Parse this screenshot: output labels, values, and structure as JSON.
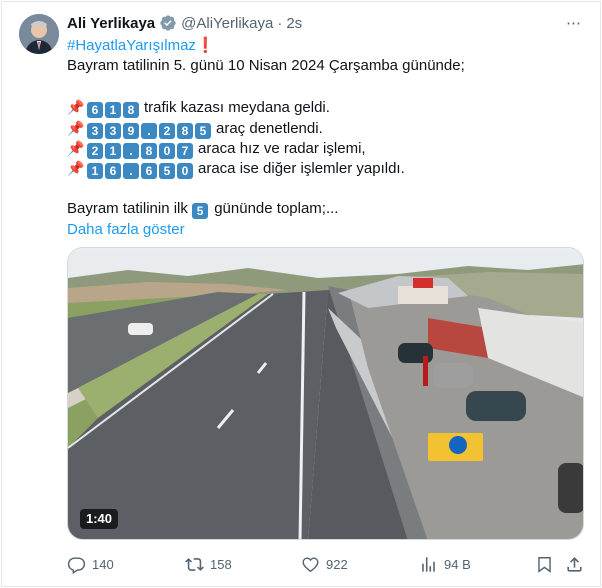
{
  "author": {
    "name": "Ali Yerlikaya",
    "handle": "@AliYerlikaya",
    "separator": "·",
    "time": "2s"
  },
  "more_icon": "⋯",
  "tweet": {
    "hashtag": "#HayatlaYarışılmaz",
    "exclamation": "❗",
    "intro": "Bayram tatilinin 5. günü 10 Nisan 2024 Çarşamba gününde;",
    "stats": [
      {
        "keys": [
          "6",
          "1",
          "8"
        ],
        "text": "trafik kazası meydana geldi."
      },
      {
        "keys": [
          "3",
          "3",
          "9",
          ".",
          "2",
          "8",
          "5"
        ],
        "text": "araç denetlendi."
      },
      {
        "keys": [
          "2",
          "1",
          ".",
          "8",
          "0",
          "7"
        ],
        "text": "araca hız ve radar işlemi,"
      },
      {
        "keys": [
          "1",
          "6",
          ".",
          "6",
          "5",
          "0"
        ],
        "text": "araca ise diğer işlemler yapıldı."
      }
    ],
    "summary_before": "Bayram tatilinin ilk",
    "summary_key": "5",
    "summary_after": "gününde toplam;...",
    "show_more": "Daha fazla göster"
  },
  "video": {
    "duration": "1:40"
  },
  "actions": {
    "replies": "140",
    "reposts": "158",
    "likes": "922",
    "views": "94 B"
  },
  "icons": {
    "verified": "verified-badge-icon",
    "pin": "pushpin-icon",
    "reply": "reply-icon",
    "repost": "repost-icon",
    "like": "heart-icon",
    "views": "views-chart-icon",
    "bookmark": "bookmark-icon",
    "share": "share-icon"
  },
  "colors": {
    "accent": "#1d9bf0",
    "text": "#0f1419",
    "muted": "#536471",
    "keycap": "#3b88c3",
    "pin": "#d93025"
  }
}
